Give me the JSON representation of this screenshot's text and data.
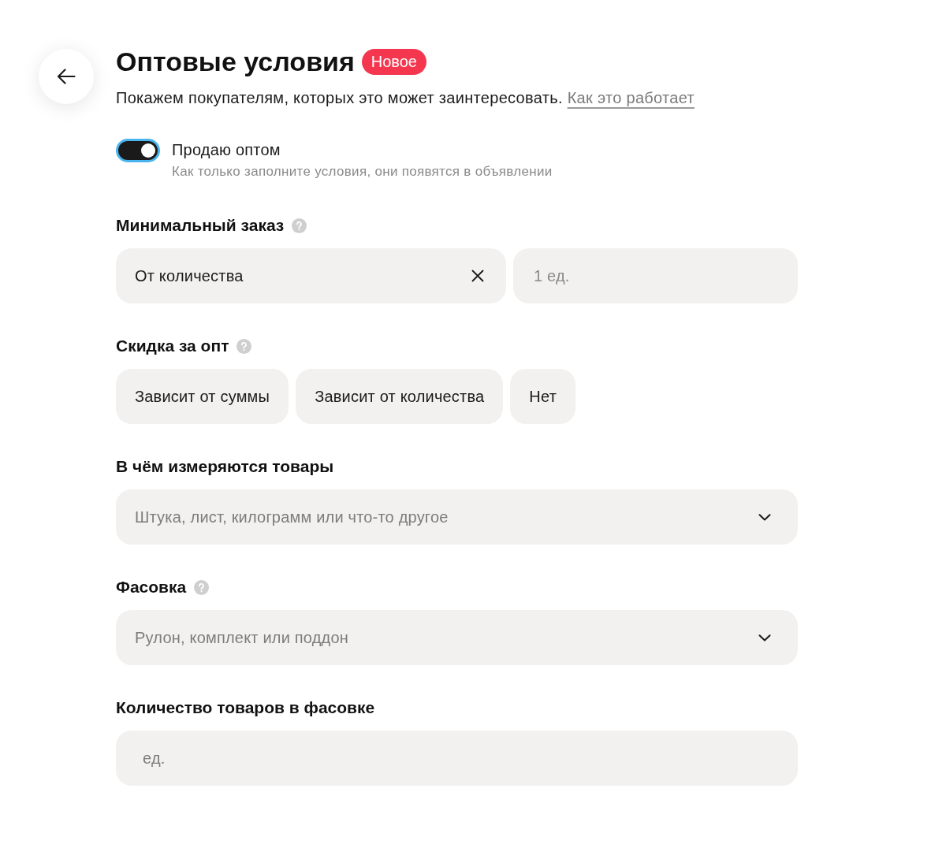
{
  "header": {
    "title": "Оптовые условия",
    "badge": "Новое",
    "description": "Покажем покупателям, которых это может заинтересовать.",
    "link": "Как это работает"
  },
  "toggle": {
    "label": "Продаю оптом",
    "hint": "Как только заполните условия, они появятся в объявлении",
    "on": true
  },
  "sections": [
    {
      "kind": "select_pair",
      "title": "Минимальный заказ",
      "help": true,
      "select": {
        "value": "От количества"
      },
      "amount": {
        "placeholder": "1 ед."
      }
    },
    {
      "kind": "chips",
      "title": "Скидка за опт",
      "help": true,
      "options": [
        {
          "label": "Зависит от суммы",
          "selected": false
        },
        {
          "label": "Зависит от количества",
          "selected": false
        },
        {
          "label": "Нет",
          "selected": false
        }
      ]
    },
    {
      "kind": "dropdown",
      "title": "В чём измеряются товары",
      "help": false,
      "placeholder": "Штука, лист, килограмм или что-то другое"
    },
    {
      "kind": "dropdown",
      "title": "Фасовка",
      "help": true,
      "placeholder": "Рулон, комплект или поддон"
    },
    {
      "kind": "input",
      "title": "Количество товаров в фасовке",
      "help": false,
      "placeholder": "ед."
    }
  ]
}
